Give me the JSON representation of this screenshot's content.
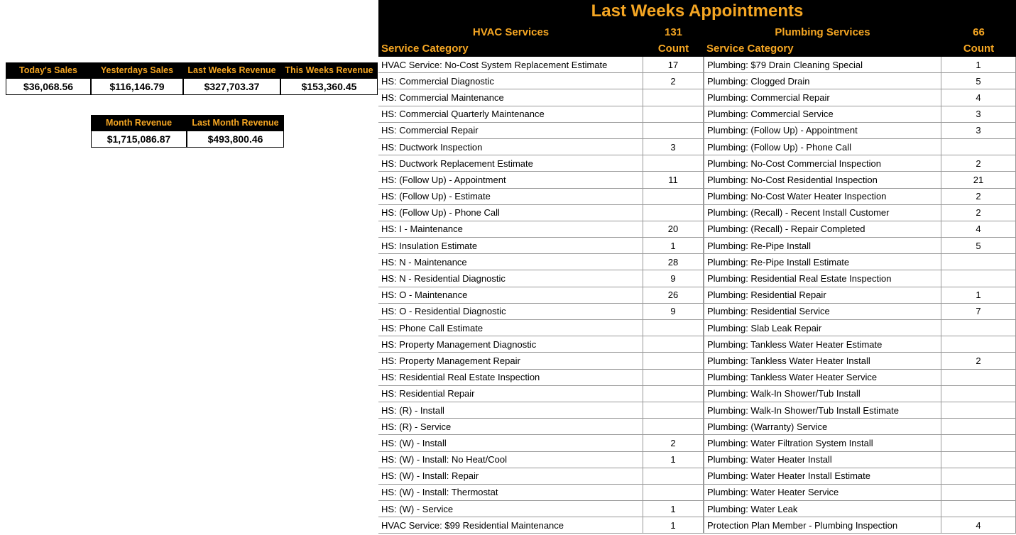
{
  "revenue": {
    "today_label": "Today's Sales",
    "today_value": "$36,068.56",
    "yesterday_label": "Yesterdays Sales",
    "yesterday_value": "$116,146.79",
    "lastweek_label": "Last Weeks Revenue",
    "lastweek_value": "$327,703.37",
    "thisweek_label": "This Weeks Revenue",
    "thisweek_value": "$153,360.45",
    "month_label": "Month Revenue",
    "month_value": "$1,715,086.87",
    "lastmonth_label": "Last Month Revenue",
    "lastmonth_value": "$493,800.46"
  },
  "appointments": {
    "title": "Last Weeks Appointments",
    "hvac_title": "HVAC Services",
    "hvac_total": "131",
    "plumb_title": "Plumbing Services",
    "plumb_total": "66",
    "cat_header": "Service Category",
    "count_header": "Count",
    "hvac_rows": [
      {
        "cat": "HVAC Service: No-Cost System Replacement Estimate",
        "cnt": "17"
      },
      {
        "cat": "HS: Commercial Diagnostic",
        "cnt": "2"
      },
      {
        "cat": "HS: Commercial Maintenance",
        "cnt": ""
      },
      {
        "cat": "HS: Commercial Quarterly Maintenance",
        "cnt": ""
      },
      {
        "cat": "HS: Commercial Repair",
        "cnt": ""
      },
      {
        "cat": "HS: Ductwork Inspection",
        "cnt": "3"
      },
      {
        "cat": "HS: Ductwork Replacement Estimate",
        "cnt": ""
      },
      {
        "cat": "HS: (Follow Up) - Appointment",
        "cnt": "11"
      },
      {
        "cat": "HS: (Follow Up) - Estimate",
        "cnt": ""
      },
      {
        "cat": "HS: (Follow Up) - Phone Call",
        "cnt": ""
      },
      {
        "cat": "HS: I - Maintenance",
        "cnt": "20"
      },
      {
        "cat": "HS: Insulation Estimate",
        "cnt": "1"
      },
      {
        "cat": "HS: N - Maintenance",
        "cnt": "28"
      },
      {
        "cat": "HS: N - Residential Diagnostic",
        "cnt": "9"
      },
      {
        "cat": "HS: O - Maintenance",
        "cnt": "26"
      },
      {
        "cat": "HS: O - Residential Diagnostic",
        "cnt": "9"
      },
      {
        "cat": "HS: Phone Call Estimate",
        "cnt": ""
      },
      {
        "cat": "HS: Property Management Diagnostic",
        "cnt": ""
      },
      {
        "cat": "HS: Property Management Repair",
        "cnt": ""
      },
      {
        "cat": "HS: Residential Real Estate Inspection",
        "cnt": ""
      },
      {
        "cat": "HS: Residential Repair",
        "cnt": ""
      },
      {
        "cat": "HS: (R) - Install",
        "cnt": ""
      },
      {
        "cat": "HS: (R) - Service",
        "cnt": ""
      },
      {
        "cat": "HS: (W) - Install",
        "cnt": "2"
      },
      {
        "cat": "HS: (W) - Install: No Heat/Cool",
        "cnt": "1"
      },
      {
        "cat": "HS: (W) - Install: Repair",
        "cnt": ""
      },
      {
        "cat": "HS: (W) - Install: Thermostat",
        "cnt": ""
      },
      {
        "cat": "HS: (W) - Service",
        "cnt": "1"
      },
      {
        "cat": "HVAC Service: $99 Residential Maintenance",
        "cnt": "1"
      }
    ],
    "plumb_rows": [
      {
        "cat": "Plumbing: $79 Drain Cleaning Special",
        "cnt": "1"
      },
      {
        "cat": "Plumbing: Clogged Drain",
        "cnt": "5"
      },
      {
        "cat": "Plumbing: Commercial Repair",
        "cnt": "4"
      },
      {
        "cat": "Plumbing: Commercial Service",
        "cnt": "3"
      },
      {
        "cat": "Plumbing: (Follow Up) - Appointment",
        "cnt": "3"
      },
      {
        "cat": "Plumbing: (Follow Up) - Phone Call",
        "cnt": ""
      },
      {
        "cat": "Plumbing: No-Cost Commercial Inspection",
        "cnt": "2"
      },
      {
        "cat": "Plumbing: No-Cost Residential Inspection",
        "cnt": "21"
      },
      {
        "cat": "Plumbing: No-Cost Water Heater Inspection",
        "cnt": "2"
      },
      {
        "cat": "Plumbing: (Recall) - Recent Install Customer",
        "cnt": "2"
      },
      {
        "cat": "Plumbing: (Recall) - Repair Completed",
        "cnt": "4"
      },
      {
        "cat": "Plumbing: Re-Pipe Install",
        "cnt": "5"
      },
      {
        "cat": "Plumbing: Re-Pipe Install Estimate",
        "cnt": ""
      },
      {
        "cat": "Plumbing: Residential Real Estate Inspection",
        "cnt": ""
      },
      {
        "cat": "Plumbing: Residential Repair",
        "cnt": "1"
      },
      {
        "cat": "Plumbing: Residential Service",
        "cnt": "7"
      },
      {
        "cat": "Plumbing: Slab Leak Repair",
        "cnt": ""
      },
      {
        "cat": "Plumbing: Tankless Water Heater Estimate",
        "cnt": ""
      },
      {
        "cat": "Plumbing: Tankless Water Heater Install",
        "cnt": "2"
      },
      {
        "cat": "Plumbing: Tankless Water Heater Service",
        "cnt": ""
      },
      {
        "cat": "Plumbing: Walk-In Shower/Tub Install",
        "cnt": ""
      },
      {
        "cat": "Plumbing: Walk-In Shower/Tub Install Estimate",
        "cnt": ""
      },
      {
        "cat": "Plumbing: (Warranty) Service",
        "cnt": ""
      },
      {
        "cat": "Plumbing: Water Filtration System Install",
        "cnt": ""
      },
      {
        "cat": "Plumbing: Water Heater Install",
        "cnt": ""
      },
      {
        "cat": "Plumbing: Water Heater Install Estimate",
        "cnt": ""
      },
      {
        "cat": "Plumbing: Water Heater Service",
        "cnt": ""
      },
      {
        "cat": "Plumbing: Water Leak",
        "cnt": ""
      },
      {
        "cat": "Protection Plan Member - Plumbing Inspection",
        "cnt": "4"
      }
    ]
  }
}
